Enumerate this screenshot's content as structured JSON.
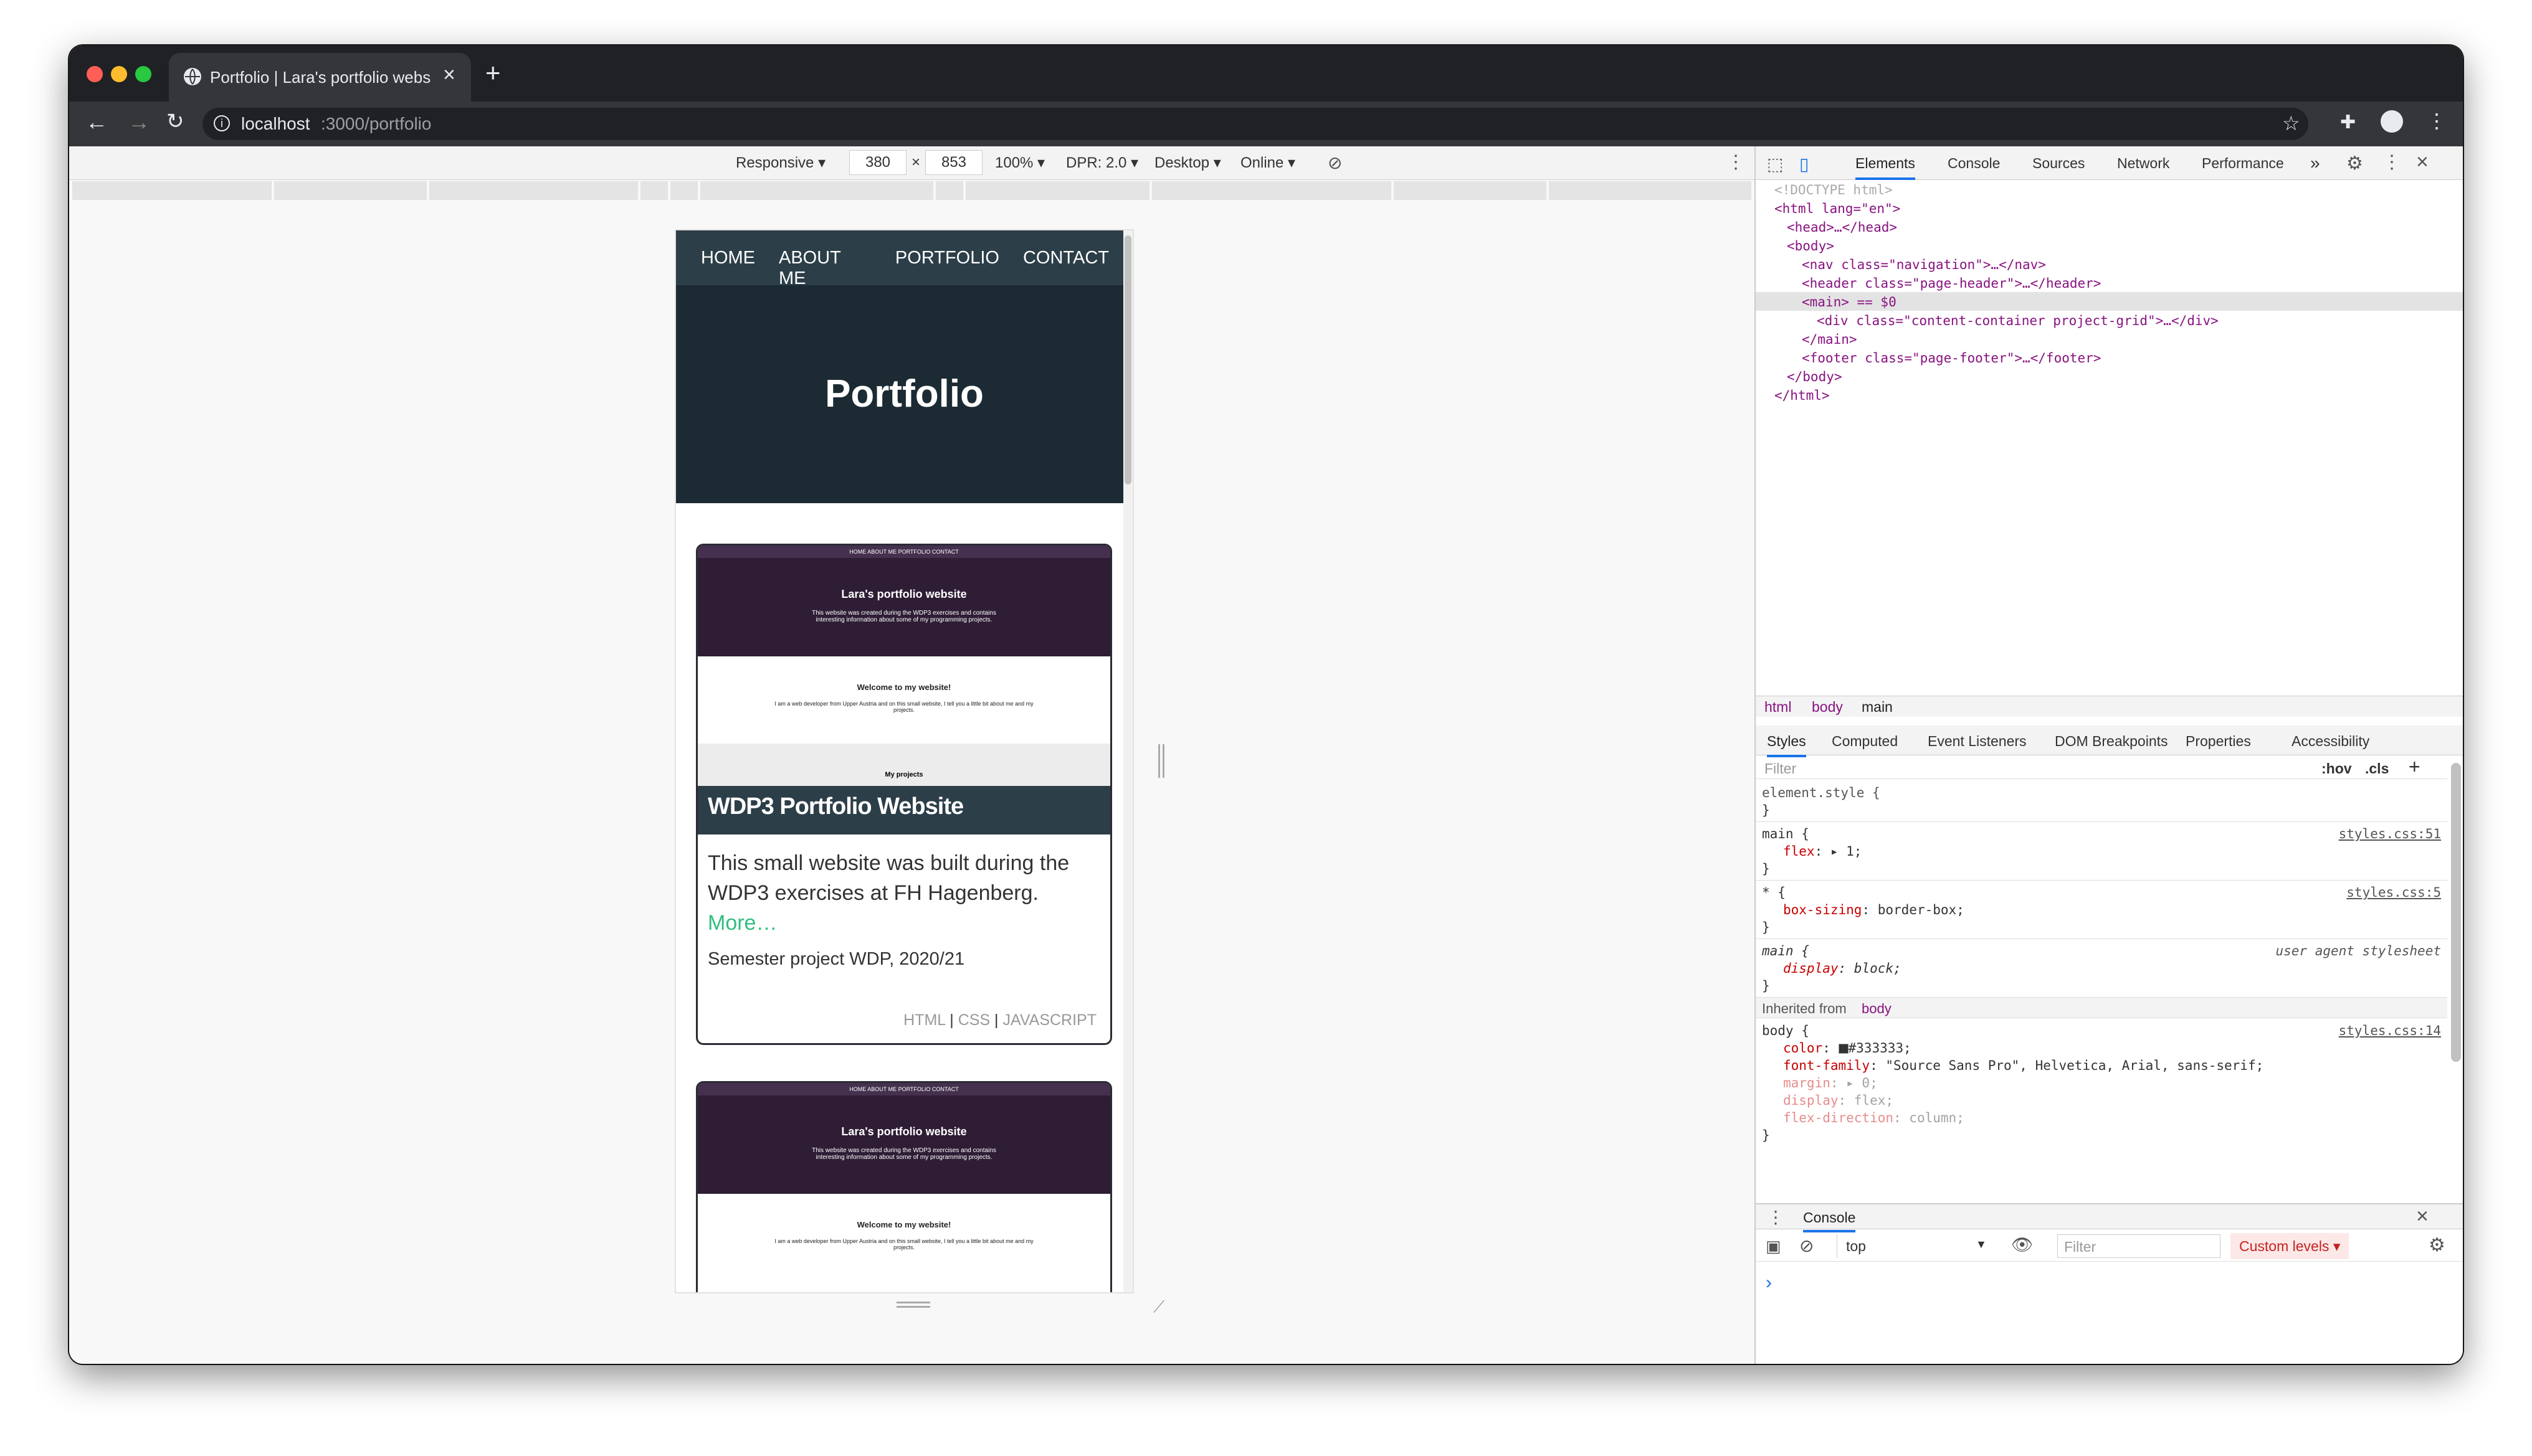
{
  "browser": {
    "tab_title": "Portfolio | Lara's portfolio webs",
    "url_host": "localhost",
    "url_path": ":3000/portfolio"
  },
  "device_toolbar": {
    "mode": "Responsive ▾",
    "width": "380",
    "times": "×",
    "height": "853",
    "zoom": "100% ▾",
    "dpr": "DPR: 2.0 ▾",
    "ua": "Desktop ▾",
    "network": "Online ▾"
  },
  "site": {
    "nav": [
      "HOME",
      "ABOUT ME",
      "PORTFOLIO",
      "CONTACT"
    ],
    "page_title": "Portfolio",
    "thumb": {
      "nav": "HOME   ABOUT ME   PORTFOLIO   CONTACT",
      "title": "Lara's portfolio website",
      "subtitle": "This website was created during the WDP3 exercises and contains interesting information about some of my programming projects.",
      "welcome": "Welcome to my website!",
      "welcome_text": "I am a web developer from Upper Austria and on this small website, I tell you a little bit about me and my projects.",
      "projects": "My projects"
    },
    "card": {
      "title": "WDP3 Portfolio Website",
      "description": "This small website was built during the WDP3 exercises at FH Hagenberg.",
      "more": "More…",
      "meta": "Semester project WDP, 2020/21",
      "tags": [
        "HTML",
        "CSS",
        "JAVASCRIPT"
      ]
    }
  },
  "devtools": {
    "tabs": [
      "Elements",
      "Console",
      "Sources",
      "Network",
      "Performance"
    ],
    "more_tabs": "»",
    "dom": {
      "doctype": "<!DOCTYPE html>",
      "html_open": "<html lang=\"en\">",
      "head": "<head>…</head>",
      "body_open": "<body>",
      "nav": "<nav class=\"navigation\">…</nav>",
      "header": "<header class=\"page-header\">…</header>",
      "main": "<main> == $0",
      "div": "<div class=\"content-container project-grid\">…</div>",
      "main_close": "</main>",
      "footer": "<footer class=\"page-footer\">…</footer>",
      "body_close": "</body>",
      "html_close": "</html>"
    },
    "breadcrumbs": [
      "html",
      "body",
      "main"
    ],
    "style_tabs": [
      "Styles",
      "Computed",
      "Event Listeners",
      "DOM Breakpoints",
      "Properties",
      "Accessibility"
    ],
    "filter_placeholder": "Filter",
    "hov": ":hov",
    "cls": ".cls",
    "rules": {
      "element_style": "element.style {",
      "close": "}",
      "main_sel": "main {",
      "main_src": "styles.css:51",
      "flex_prop": "flex",
      "flex_val": ": ▸ 1;",
      "star_sel": "* {",
      "star_src": "styles.css:5",
      "bs_prop": "box-sizing",
      "bs_val": ": border-box;",
      "ua_sel": "main {",
      "ua_src": "user agent stylesheet",
      "display_prop": "display",
      "display_val": ": block;",
      "inherited": "Inherited from",
      "inherited_el": "body",
      "body_sel": "body {",
      "body_src": "styles.css:14",
      "color_prop": "color",
      "color_val": "#333333;",
      "ff_prop": "font-family",
      "ff_val": ": \"Source Sans Pro\", Helvetica, Arial, sans-serif;",
      "margin_prop": "margin",
      "margin_val": ": ▸ 0;",
      "disp2_prop": "display",
      "disp2_val": ": flex;",
      "fd_prop": "flex-direction",
      "fd_val": ": column;"
    },
    "console": {
      "title": "Console",
      "context": "top",
      "filter_placeholder": "Filter",
      "levels": "Custom levels ▾",
      "prompt": "›"
    }
  },
  "colors": {
    "site_dark": "#1c2a33",
    "card_title_bg": "#2c3e48",
    "thumb_purple": "#2e1d35",
    "link_green": "#2ebf7e"
  }
}
